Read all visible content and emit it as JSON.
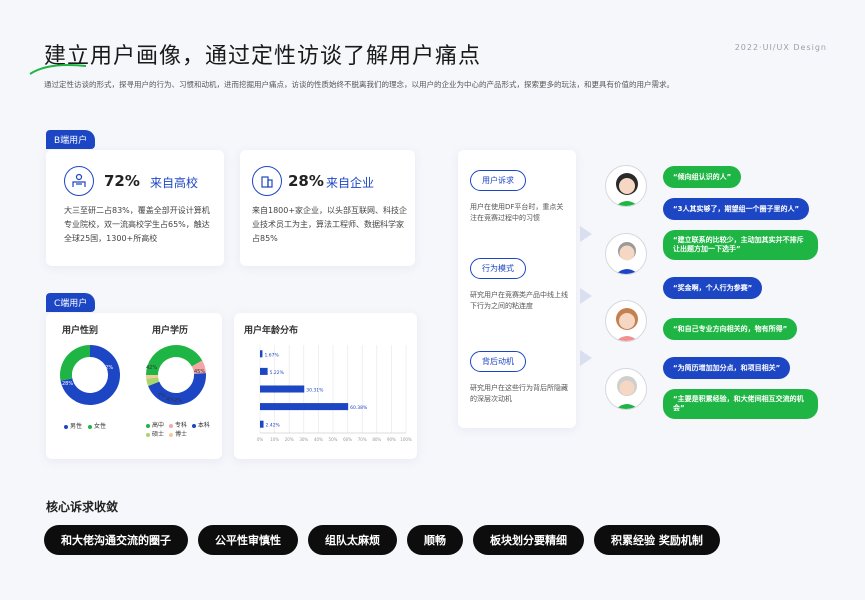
{
  "header": {
    "title": "建立用户画像，通过定性访谈了解用户痛点",
    "brand": "2022·UI/UX Design",
    "subtitle": "通过定性访谈的形式，探寻用户的行为、习惯和动机，进而挖掘用户痛点，访谈的性质始终不脱离我们的理念，以用户的企业为中心的产品形式，探索更多的玩法，和更具有价值的用户需求。"
  },
  "b_users": {
    "tag": "B端用户",
    "school": {
      "num": "72%",
      "label": "来自高校",
      "desc": "大三至研二占83%，覆盖全部开设计算机专业院校，双一流高校学生占65%，触达全球25国，1300+所高校"
    },
    "company": {
      "num": "28%",
      "label": "来自企业",
      "desc": "来自1800+家企业，以头部互联网、科技企业技术员工为主，算法工程师、数据科学家占85%"
    }
  },
  "c_users": {
    "tag": "C端用户",
    "gender": {
      "title": "用户性别",
      "male_pct": "72%",
      "female_pct": "28%",
      "legend": [
        "男性",
        "女性"
      ]
    },
    "education": {
      "title": "用户学历",
      "labels_pct": [
        "42%",
        "45%",
        "7%",
        "4%",
        "2%"
      ],
      "legend": [
        "高中",
        "专科",
        "本科",
        "硕士",
        "博士"
      ]
    },
    "age": {
      "title": "用户年龄分布"
    }
  },
  "chart_data": [
    {
      "type": "pie",
      "title": "用户性别",
      "categories": [
        "男性",
        "女性"
      ],
      "values": [
        72,
        28
      ],
      "colors": [
        "#1d46c4",
        "#1fb544"
      ]
    },
    {
      "type": "pie",
      "title": "用户学历",
      "categories": [
        "高中",
        "专科",
        "本科",
        "硕士",
        "博士"
      ],
      "values": [
        42,
        7,
        45,
        4,
        2
      ],
      "colors": [
        "#1fb544",
        "#f4a6a6",
        "#1d46c4",
        "#a8d66a",
        "#f5c9a0"
      ]
    },
    {
      "type": "bar",
      "title": "用户年龄分布",
      "orientation": "horizontal",
      "categories": [
        "",
        "",
        "",
        "",
        ""
      ],
      "values": [
        1.67,
        5.22,
        30.31,
        60.38,
        2.42
      ],
      "value_labels": [
        "1.67%",
        "5.22%",
        "30.31%",
        "60.38%",
        "2.42%"
      ],
      "xlim": [
        0,
        100
      ],
      "x_ticks": [
        "0%",
        "10%",
        "20%",
        "30%",
        "40%",
        "50%",
        "60%",
        "70%",
        "80%",
        "90%",
        "100%"
      ],
      "grid": true
    }
  ],
  "motives": [
    {
      "label": "用户诉求",
      "desc": "用户在使用DF平台时，重点关注在竞赛过程中的习惯"
    },
    {
      "label": "行为模式",
      "desc": "研究用户在竞赛类产品中线上线下行为之间的粘连度"
    },
    {
      "label": "背后动机",
      "desc": "研究用户在这些行为背后所隐藏的深层次动机"
    }
  ],
  "quotes": [
    "“倾向组认识的人”",
    "“3人其实够了，期望组一个圈子里的人”",
    "“建立联系的比较少，主动加其实并不排斥让出题方加一下选手”",
    "“奖金啊，个人行为参赛”",
    "“和自己专业方向相关的，物有所得”",
    "“为简历增加加分点，和项目相关”",
    "“主要是积累经验，和大佬间相互交流的机会”"
  ],
  "core": {
    "title": "核心诉求收敛",
    "chips": [
      "和大佬沟通交流的圈子",
      "公平性审慎性",
      "组队太麻烦",
      "顺畅",
      "板块划分要精细",
      "积累经验 奖励机制"
    ]
  }
}
